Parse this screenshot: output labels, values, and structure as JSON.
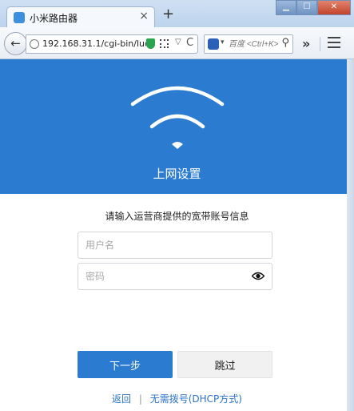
{
  "browser": {
    "tab_title": "小米路由器",
    "tab_close": "×",
    "new_tab": "+",
    "window_buttons": {
      "minimize": "▁",
      "maximize": "☐",
      "close": "✕"
    },
    "back": "←",
    "url": "192.168.31.1/cgi-bin/luc",
    "dropdown": "▽",
    "reload": "C",
    "search_placeholder": "百度 <Ctrl+K>",
    "search_dropdown": "▾",
    "search_icon": "⚲",
    "overflow": "»"
  },
  "page": {
    "title": "上网设置",
    "instruction": "请输入运营商提供的宽带账号信息",
    "username_placeholder": "用户名",
    "password_placeholder": "密码",
    "next_label": "下一步",
    "skip_label": "跳过",
    "back_link": "返回",
    "separator": "|",
    "dhcp_link": "无需拨号(DHCP方式)"
  },
  "colors": {
    "brand_blue": "#2b7bd0",
    "link_blue": "#2b73c8",
    "security_green": "#2aa44f"
  },
  "icons": [
    "wifi-icon",
    "eye-icon",
    "globe-icon",
    "shield-icon",
    "qr-code-icon",
    "search-icon",
    "menu-icon"
  ]
}
